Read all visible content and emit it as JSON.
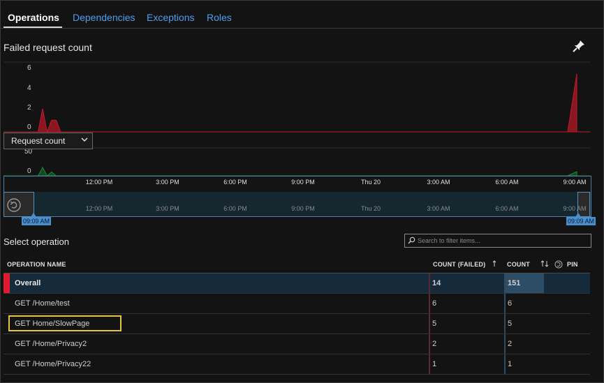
{
  "tabs": [
    {
      "label": "Operations",
      "active": true
    },
    {
      "label": "Dependencies",
      "active": false
    },
    {
      "label": "Exceptions",
      "active": false
    },
    {
      "label": "Roles",
      "active": false
    }
  ],
  "chart_section": {
    "title": "Failed request count",
    "pin_icon": "pin-icon",
    "metric_dropdown": "Request count"
  },
  "chart_data": [
    {
      "type": "area",
      "ylim": [
        0,
        6
      ],
      "yticks": [
        "6",
        "4",
        "2",
        "0"
      ],
      "color": "#e01b2f",
      "series": [
        {
          "points": [
            [
              0,
              0
            ],
            [
              0.5,
              0
            ],
            [
              1,
              2
            ],
            [
              1.5,
              0
            ],
            [
              2,
              1
            ],
            [
              2.5,
              1
            ],
            [
              3,
              0
            ],
            [
              59,
              0
            ],
            [
              60,
              5
            ]
          ]
        }
      ]
    },
    {
      "type": "area",
      "ylim": [
        0,
        60
      ],
      "yticks": [
        "50",
        "0"
      ],
      "color": "#1f7a3a",
      "series": [
        {
          "points": [
            [
              0,
              0
            ],
            [
              0.5,
              0
            ],
            [
              1,
              18
            ],
            [
              1.5,
              0
            ],
            [
              2,
              8
            ],
            [
              2.5,
              0
            ],
            [
              59,
              0
            ],
            [
              60,
              9
            ]
          ]
        }
      ]
    }
  ],
  "time_axis": {
    "labels": [
      "12:00 PM",
      "3:00 PM",
      "6:00 PM",
      "9:00 PM",
      "Thu 20",
      "3:00 AM",
      "6:00 AM",
      "9:00 AM"
    ],
    "range_start": "09:09 AM",
    "range_end": "09:09 AM"
  },
  "operations": {
    "title": "Select operation",
    "search_placeholder": "Search to filter items...",
    "columns": {
      "name": "OPERATION NAME",
      "failed": "COUNT (FAILED)",
      "count": "COUNT",
      "pin": "PIN"
    },
    "rows": [
      {
        "name": "Overall",
        "failed": "14",
        "count": "151",
        "overall": true,
        "count_fraction": 1.0
      },
      {
        "name": "GET /Home/test",
        "failed": "6",
        "count": "6",
        "count_fraction": 0.04
      },
      {
        "name": "GET Home/SlowPage",
        "failed": "5",
        "count": "5",
        "count_fraction": 0.033,
        "highlighted": true
      },
      {
        "name": "GET /Home/Privacy2",
        "failed": "2",
        "count": "2",
        "count_fraction": 0.013
      },
      {
        "name": "GET /Home/Privacy22",
        "failed": "1",
        "count": "1",
        "count_fraction": 0.007
      }
    ]
  },
  "colors": {
    "accent": "#4aa0f0",
    "failed": "#e01b2f",
    "success": "#1f7a3a",
    "highlight": "#e8c43c"
  }
}
